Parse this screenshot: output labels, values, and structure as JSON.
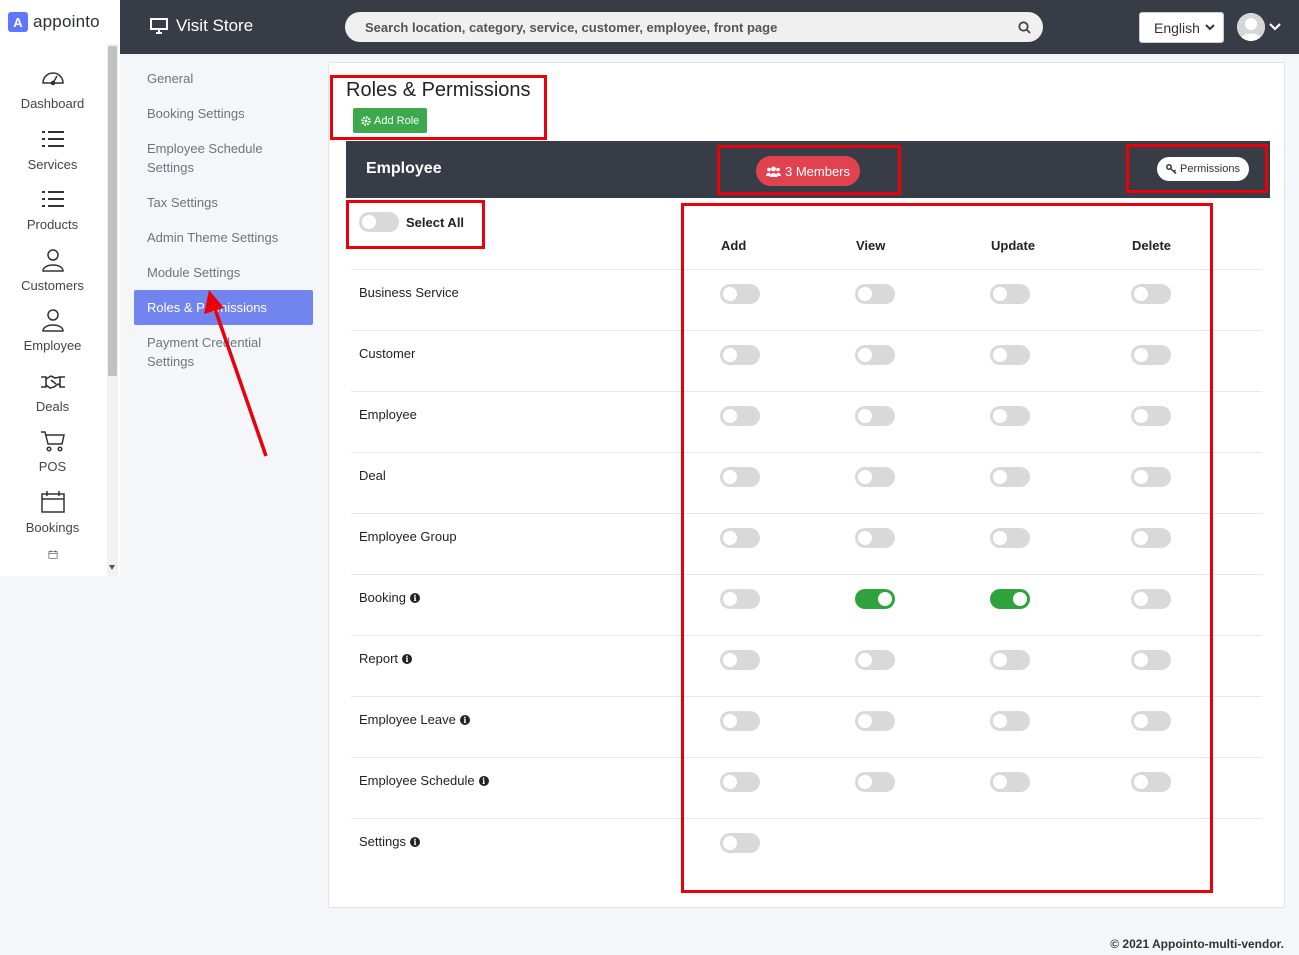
{
  "brand": {
    "logo_letter": "A",
    "name": "appointo",
    "color": "#5d78ff"
  },
  "sidebar": {
    "items": [
      {
        "label": "Dashboard",
        "icon": "dashboard-icon"
      },
      {
        "label": "Services",
        "icon": "list-icon"
      },
      {
        "label": "Products",
        "icon": "list-icon"
      },
      {
        "label": "Customers",
        "icon": "user-icon"
      },
      {
        "label": "Employee",
        "icon": "user-icon"
      },
      {
        "label": "Deals",
        "icon": "handshake-icon"
      },
      {
        "label": "POS",
        "icon": "cart-icon"
      },
      {
        "label": "Bookings",
        "icon": "calendar-icon"
      }
    ]
  },
  "topbar": {
    "visit_store": "Visit Store",
    "search_placeholder": "Search location, category, service, customer, employee, front page",
    "language": "English"
  },
  "settings_menu": {
    "items": [
      "General",
      "Booking Settings",
      "Employee Schedule Settings",
      "Tax Settings",
      "Admin Theme Settings",
      "Module Settings",
      "Roles & Permissions",
      "Payment Credential Settings"
    ],
    "active": "Roles & Permissions"
  },
  "page": {
    "title": "Roles & Permissions",
    "add_role": "Add Role"
  },
  "role": {
    "name": "Employee",
    "members": "3 Members",
    "permissions_button": "Permissions",
    "select_all": "Select All",
    "columns": [
      "Add",
      "View",
      "Update",
      "Delete"
    ],
    "rows": [
      {
        "label": "Business Service",
        "info": false,
        "add": false,
        "view": false,
        "update": false,
        "delete": false
      },
      {
        "label": "Customer",
        "info": false,
        "add": false,
        "view": false,
        "update": false,
        "delete": false
      },
      {
        "label": "Employee",
        "info": false,
        "add": false,
        "view": false,
        "update": false,
        "delete": false
      },
      {
        "label": "Deal",
        "info": false,
        "add": false,
        "view": false,
        "update": false,
        "delete": false
      },
      {
        "label": "Employee Group",
        "info": false,
        "add": false,
        "view": false,
        "update": false,
        "delete": false
      },
      {
        "label": "Booking",
        "info": true,
        "add": false,
        "view": true,
        "update": true,
        "delete": false
      },
      {
        "label": "Report",
        "info": true,
        "add": false,
        "view": false,
        "update": false,
        "delete": false
      },
      {
        "label": "Employee Leave",
        "info": true,
        "add": false,
        "view": false,
        "update": false,
        "delete": false
      },
      {
        "label": "Employee Schedule",
        "info": true,
        "add": false,
        "view": false,
        "update": false,
        "delete": false
      },
      {
        "label": "Settings",
        "info": true,
        "add": false,
        "view": null,
        "update": null,
        "delete": null
      }
    ]
  },
  "colors": {
    "topbar": "#383c46",
    "active_menu": "#7284ee",
    "add_role": "#3caa4c",
    "members": "#e0434f",
    "toggle_on": "#2ea23c",
    "annotation": "#e8000a"
  },
  "footer": "© 2021 Appointo-multi-vendor."
}
